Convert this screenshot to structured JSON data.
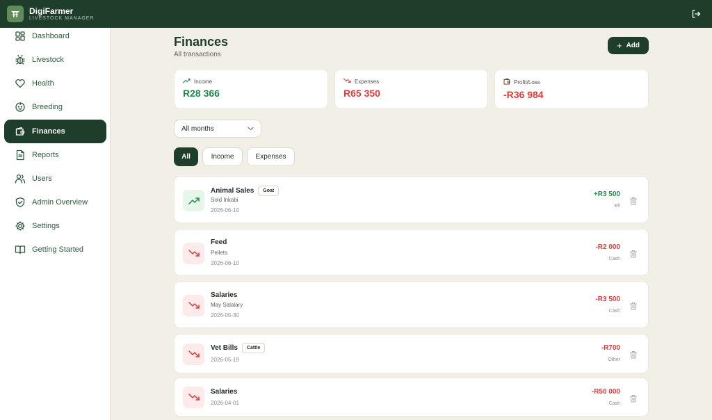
{
  "app": {
    "name": "DigiFarmer",
    "subtitle": "LIVESTOCK MANAGER"
  },
  "sidebar": {
    "items": [
      {
        "label": "Dashboard",
        "icon": "dashboard-icon"
      },
      {
        "label": "Livestock",
        "icon": "bug-icon"
      },
      {
        "label": "Health",
        "icon": "heart-icon"
      },
      {
        "label": "Breeding",
        "icon": "baby-icon"
      },
      {
        "label": "Finances",
        "icon": "wallet-icon",
        "active": true
      },
      {
        "label": "Reports",
        "icon": "file-text-icon"
      },
      {
        "label": "Users",
        "icon": "users-icon"
      },
      {
        "label": "Admin Overview",
        "icon": "shield-icon"
      },
      {
        "label": "Settings",
        "icon": "gear-icon"
      },
      {
        "label": "Getting Started",
        "icon": "book-icon"
      }
    ]
  },
  "header": {
    "title": "Finances",
    "subtitle": "All transactions",
    "add_label": "Add"
  },
  "stats": {
    "income": {
      "label": "Income",
      "value": "R28 366",
      "color": "#1f8a4c"
    },
    "expenses": {
      "label": "Expenses",
      "value": "R65 350",
      "color": "#e03b3b"
    },
    "profit": {
      "label": "Profit/Loss",
      "value": "-R36 984",
      "color": "#e03b3b"
    }
  },
  "filter": {
    "selected": "All months"
  },
  "tabs": [
    {
      "label": "All"
    },
    {
      "label": "Income"
    },
    {
      "label": "Expenses"
    }
  ],
  "transactions": [
    {
      "title": "Animal Sales",
      "badge": "Goat",
      "desc": "Sold Inkabi",
      "date": "2026-06-10",
      "amount": "+R3 500",
      "method": "Eft",
      "type": "income"
    },
    {
      "title": "Feed",
      "badge": "",
      "desc": "Pellets",
      "date": "2026-06-10",
      "amount": "-R2 000",
      "method": "Cash",
      "type": "expense"
    },
    {
      "title": "Salaries",
      "badge": "",
      "desc": "May Salalary",
      "date": "2026-05-30",
      "amount": "-R3 500",
      "method": "Cash",
      "type": "expense"
    },
    {
      "title": "Vet Bills",
      "badge": "Cattle",
      "desc": "",
      "date": "2026-05-19",
      "amount": "-R700",
      "method": "Other",
      "type": "expense"
    },
    {
      "title": "Salaries",
      "badge": "",
      "desc": "",
      "date": "2026-04-01",
      "amount": "-R50 000",
      "method": "Cash",
      "type": "expense"
    }
  ],
  "colors": {
    "brand": "#1e3d2b",
    "income": "#1f8a4c",
    "expense": "#e03b3b",
    "background": "#f2efe7"
  }
}
